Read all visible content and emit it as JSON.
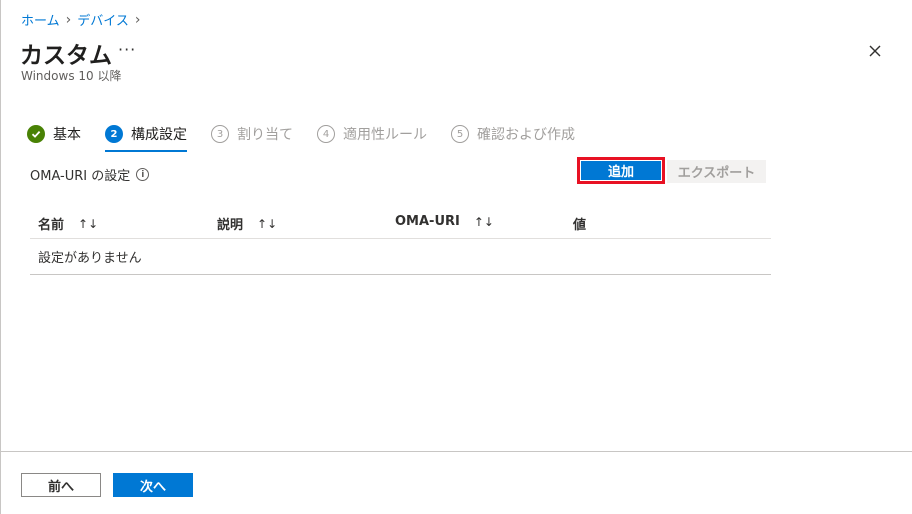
{
  "breadcrumb": {
    "items": [
      "ホーム",
      "デバイス"
    ]
  },
  "header": {
    "title": "カスタム",
    "more": "···",
    "subtitle": "Windows 10 以降"
  },
  "steps": [
    {
      "number": "",
      "label": "基本",
      "state": "done"
    },
    {
      "number": "2",
      "label": "構成設定",
      "state": "active"
    },
    {
      "number": "3",
      "label": "割り当て",
      "state": "todo"
    },
    {
      "number": "4",
      "label": "適用性ルール",
      "state": "todo"
    },
    {
      "number": "5",
      "label": "確認および作成",
      "state": "todo"
    }
  ],
  "oma": {
    "label": "OMA-URI の設定",
    "info": "i"
  },
  "actions": {
    "add": "追加",
    "export": "エクスポート"
  },
  "table": {
    "columns": [
      {
        "label": "名前",
        "sortable": true
      },
      {
        "label": "説明",
        "sortable": true
      },
      {
        "label": "OMA-URI",
        "sortable": true
      },
      {
        "label": "値",
        "sortable": false
      }
    ],
    "sort_glyph": "↑↓",
    "empty": "設定がありません"
  },
  "footer": {
    "prev": "前へ",
    "next": "次へ"
  },
  "colors": {
    "accent": "#0078d4",
    "success": "#498205",
    "highlight": "#e81123"
  }
}
